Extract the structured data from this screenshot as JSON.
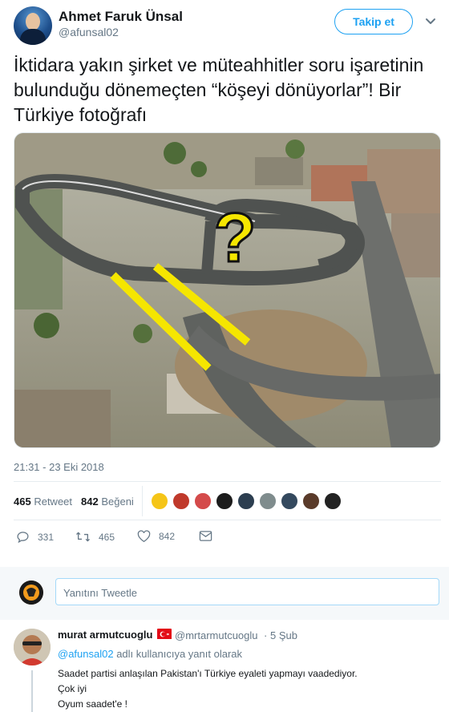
{
  "author": {
    "name": "Ahmet Faruk Ünsal",
    "handle": "@afunsal02"
  },
  "follow_label": "Takip et",
  "tweet": {
    "text": "İktidara yakın şirket ve müteahhitler soru işaretinin bulunduğu  dönemeçten “köşeyi dönüyorlar”! Bir Türkiye fotoğrafı",
    "image_overlay": "?",
    "timestamp": "21:31 - 23 Eki 2018"
  },
  "stats": {
    "retweets": "465",
    "retweets_label": "Retweet",
    "likes": "842",
    "likes_label": "Beğeni"
  },
  "liker_colors": [
    "#f5c518",
    "#c0392b",
    "#d44a4a",
    "#1c1c1c",
    "#2c3e50",
    "#7f8c8d",
    "#34495e",
    "#5a3b2a",
    "#222222"
  ],
  "actions": {
    "reply_count": "331",
    "retweet_count": "465",
    "like_count": "842"
  },
  "reply_box": {
    "placeholder": "Yanıtını Tweetle"
  },
  "reply": {
    "name": "murat armutcuoglu",
    "handle": "@mrtarmutcuoglu",
    "sep": "·",
    "date": "5 Şub",
    "replying_to_handle": "@afunsal02",
    "replying_to_suffix": "adlı kullanıcıya yanıt olarak",
    "lines": [
      "Saadet partisi anlaşılan Pakistan'ı Türkiye eyaleti yapmayı vaadediyor.",
      "Çok iyi",
      "Oyum saadet'e !"
    ]
  },
  "colors": {
    "accent": "#1da1f2",
    "text": "#14171a",
    "muted": "#657786",
    "overlay": "#f5e600"
  }
}
